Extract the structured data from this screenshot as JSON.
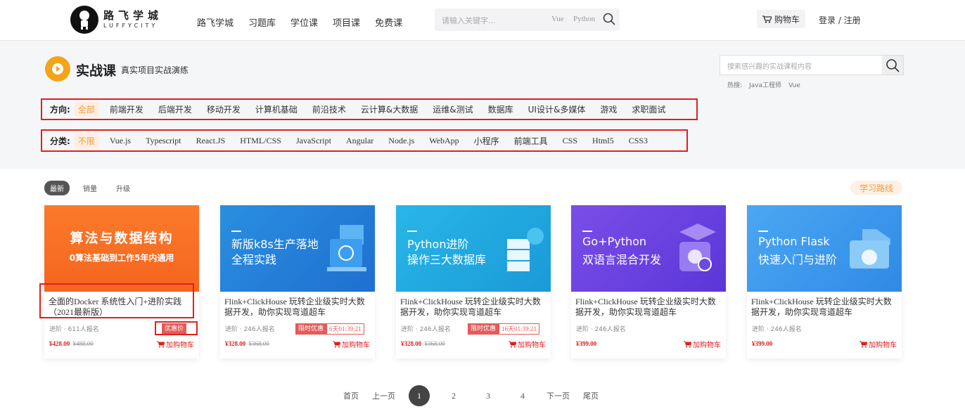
{
  "header": {
    "logo_cn": "路飞学城",
    "logo_en": "LUFFYCITY",
    "nav": [
      "路飞学城",
      "习题库",
      "学位课",
      "项目课",
      "免费课"
    ],
    "search_placeholder": "请输入关键字...",
    "search_tags": [
      "Vue",
      "Python"
    ],
    "cart_label": "购物车",
    "auth_text": "登录 / 注册"
  },
  "section": {
    "title": "实战课",
    "subtitle": "真实项目实战演练",
    "search_placeholder": "搜索感兴趣的实战课程内容",
    "hot_label": "热搜:",
    "hot_items": [
      "Java工程师",
      "Vue"
    ]
  },
  "filters": {
    "direction_label": "方向:",
    "directions": [
      "全部",
      "前端开发",
      "后端开发",
      "移动开发",
      "计算机基础",
      "前沿技术",
      "云计算&大数据",
      "运维&测试",
      "数据库",
      "UI设计&多媒体",
      "游戏",
      "求职面试"
    ],
    "category_label": "分类:",
    "categories": [
      "不限",
      "Vue.js",
      "Typescript",
      "React.JS",
      "HTML/CSS",
      "JavaScript",
      "Angular",
      "Node.js",
      "WebApp",
      "小程序",
      "前端工具",
      "CSS",
      "Html5",
      "CSS3"
    ]
  },
  "sort": [
    "最新",
    "销量",
    "升级"
  ],
  "route_label": "学习路线",
  "cards": [
    {
      "img_line1": "算法与数据结构",
      "img_line2": "0算法基础到工作5年内通用",
      "name": "全面的Docker 系统性入门+进阶实践（2021最新版）",
      "meta": "进阶 · 611人报名",
      "price": "¥428.00",
      "old_price": "¥488.00",
      "badge1": "优惠价",
      "badge2": "",
      "add": "加购物车"
    },
    {
      "img_line1": "新版k8s生产落地",
      "img_line2": "全程实践",
      "name": "Flink+ClickHouse 玩转企业级实时大数据开发，助你实现弯道超车",
      "meta": "进阶 · 246人报名",
      "price": "¥328.00",
      "old_price": "¥368.00",
      "badge1": "限时优惠",
      "badge2": "6天01:39:21",
      "add": "加购物车"
    },
    {
      "img_line1": "Python进阶",
      "img_line2": "操作三大数据库",
      "name": "Flink+ClickHouse 玩转企业级实时大数据开发，助你实现弯道超车",
      "meta": "进阶 · 246人报名",
      "price": "¥328.00",
      "old_price": "¥368.00",
      "badge1": "限时优惠",
      "badge2": "16天01:39:21",
      "add": "加购物车"
    },
    {
      "img_line1": "Go+Python",
      "img_line2": "双语言混合开发",
      "name": "Flink+ClickHouse 玩转企业级实时大数据开发，助你实现弯道超车",
      "meta": "进阶 · 246人报名",
      "price": "¥399.00",
      "old_price": "",
      "badge1": "",
      "badge2": "",
      "add": "加购物车"
    },
    {
      "img_line1": "Python Flask",
      "img_line2": "快速入门与进阶",
      "name": "Flink+ClickHouse 玩转企业级实时大数据开发，助你实现弯道超车",
      "meta": "进阶 · 246人报名",
      "price": "¥399.00",
      "old_price": "",
      "badge1": "",
      "badge2": "",
      "add": "加购物车"
    }
  ],
  "pager": {
    "first": "首页",
    "prev": "上一页",
    "pages": [
      "1",
      "2",
      "3",
      "4"
    ],
    "current": "1",
    "next": "下一页",
    "last": "尾页"
  },
  "colors": {
    "accent": "#f39c40",
    "price_red": "#e02020",
    "annotation_red": "#e02020"
  }
}
